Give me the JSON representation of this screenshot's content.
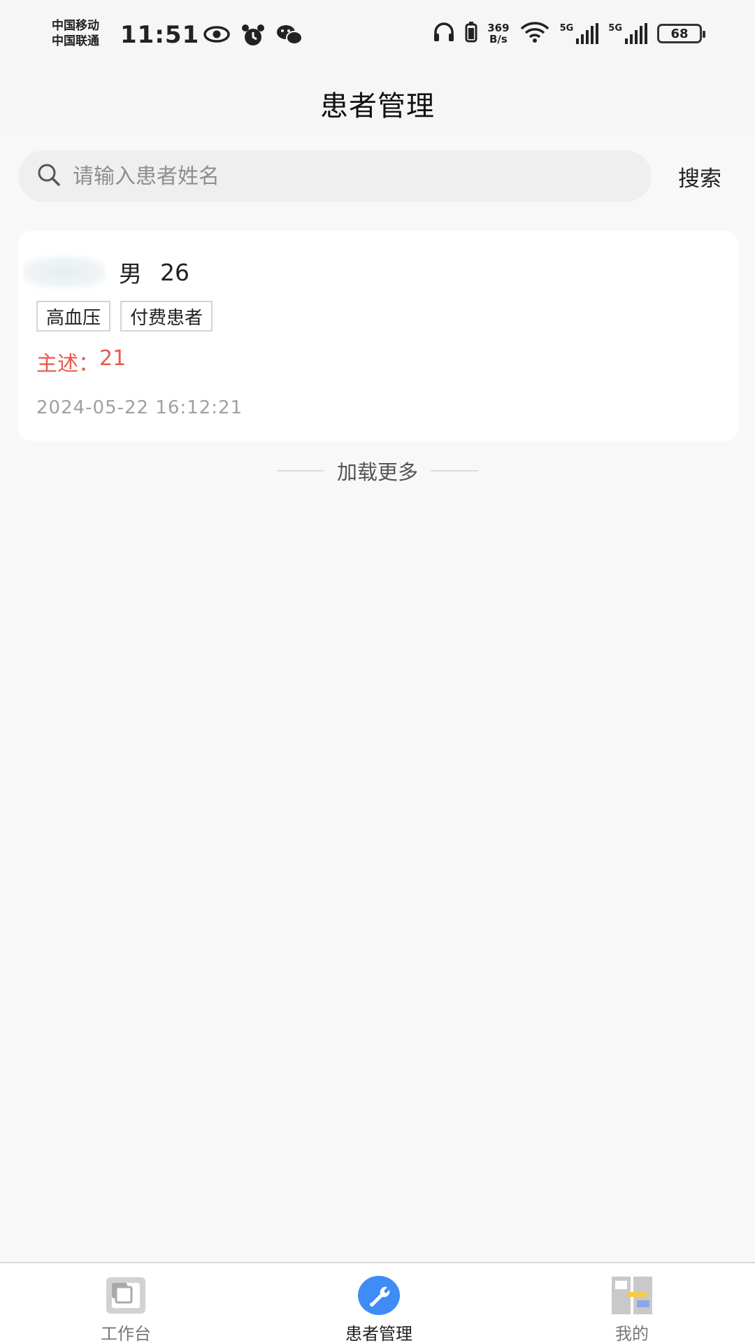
{
  "status_bar": {
    "carrier_1": "中国移动",
    "carrier_2": "中国联通",
    "time": "11:51",
    "net_speed_value": "369",
    "net_speed_unit": "B/s",
    "network_1": "5G",
    "network_2": "5G",
    "battery": "68",
    "icons": [
      "eye-icon",
      "alarm-icon",
      "wechat-icon",
      "headphones-icon",
      "battery-small-icon",
      "wifi-icon",
      "signal-icon",
      "signal-icon",
      "battery-icon"
    ]
  },
  "header": {
    "title": "患者管理"
  },
  "search": {
    "placeholder": "请输入患者姓名",
    "value": "",
    "button_label": "搜索"
  },
  "patients": [
    {
      "gender": "男",
      "age": "26",
      "tags": [
        "高血压",
        "付费患者"
      ],
      "complaint_label": "主述：",
      "complaint_value": "21",
      "timestamp": "2024-05-22 16:12:21"
    }
  ],
  "load_more": {
    "label": "加载更多"
  },
  "tab_bar": {
    "tabs": [
      {
        "label": "工作台",
        "icon": "workbench-icon",
        "active": false
      },
      {
        "label": "患者管理",
        "icon": "wrench-icon",
        "active": true
      },
      {
        "label": "我的",
        "icon": "profile-grid-icon",
        "active": false
      }
    ]
  },
  "colors": {
    "accent_blue": "#3f8cf6",
    "complaint_red": "#e8594f",
    "background": "#f8f8f8"
  }
}
